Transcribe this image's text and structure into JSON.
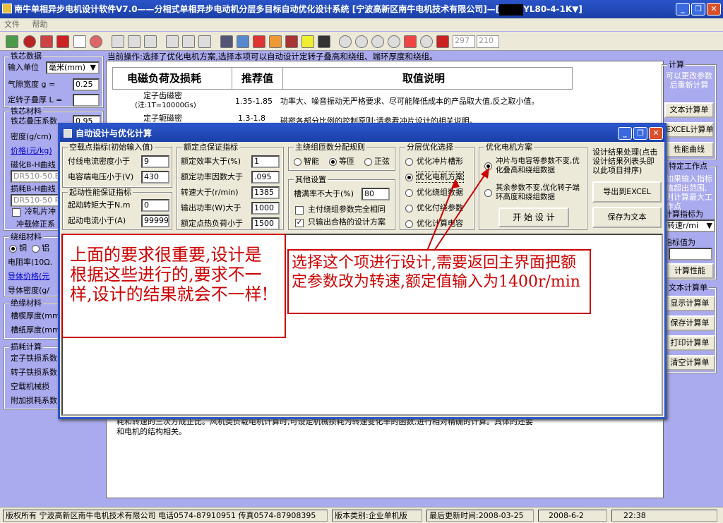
{
  "window": {
    "title": "南牛单相异步电机设计软件V7.0——分相式单相异步电动机分层多目标自动优化设计系统  [宁波高新区南牛电机技术有限公司]—[",
    "title_suffix": "YL80-4-1K▼]",
    "btn_min": "_",
    "btn_max": "❐",
    "btn_close": "✕"
  },
  "menu": {
    "file": "文件",
    "help": "帮助"
  },
  "toolbar": {
    "field1": "297",
    "field2": "210"
  },
  "left": {
    "core_group": "铁芯数据",
    "unit_label": "输入单位",
    "unit_value": "毫米(mm)",
    "gap_label": "气隙宽度  g =",
    "gap_value": "0.25",
    "stack_label": "定转子叠厚 L =",
    "material_group": "铁芯材料",
    "lam_label": "铁芯叠压系数",
    "lam_value": "0.95",
    "density_label": "密度(g/cm)",
    "price_label": "价格(元/kg)",
    "bh1_label": "磁化B-H曲线",
    "bh1_value": "DR510-50.B",
    "loss_label": "损耗B-H曲线",
    "loss_value": "DR510-50 P",
    "punch_label": "冷轧片冲",
    "punch2_label": "冲载修正系",
    "winding_group": "绕组材料",
    "copper": "铜",
    "alu": "铝",
    "resist_label": "电阻率(10Ω.",
    "wireprice_label": "导体价格(元",
    "wiredens_label": "导体密度(g/",
    "insul_group": "绝缘材料",
    "slotwedge_label": "槽楔厚度(mm",
    "slotpaper_label": "槽纸厚度(mm",
    "losscalc_group": "损耗计算",
    "stator_loss": "定子铁损系数",
    "rotor_loss": "转子铁损系数",
    "mech_loss": "空载机械损",
    "add_loss": "附加损耗系数"
  },
  "panel": {
    "op_label": "当前操作:选择了优化电机方案,选择本项可以自动设计定转子叠高和绕组、端环厚度和绕组。",
    "h_loss": "电磁负荷及损耗",
    "h_rec": "推荐值",
    "h_desc": "取值说明",
    "r1_name": "定子齿磁密",
    "r1_sub": "(注:1T=10000Gs)",
    "r1_val": "1.35-1.85",
    "r1_desc": "功率大、噪音振动无严格要求、尽可能降低成本的产品取大值,反之取小值。",
    "r2_name": "定子轭磁密",
    "r2_val": "1.3-1.8",
    "r2_desc": "磁密各部分比例的控制原则:请参看冲片设计的相关说明。",
    "footer1": "耗和转速的三次方成正比。风机类负载电机计算时,可设定机械损耗为转速变化率的函数,进行相对精确的计算。具体的还要",
    "footer2": "和电机的结构相关。"
  },
  "right": {
    "calc_group": "计算",
    "calc_hint": "可以更改参数后重新计算",
    "text_calc": "文本计算单",
    "excel_calc": "EXCEL计算单",
    "perf_curve": "性能曲线",
    "point_group": "特定工作点",
    "point_hint": "如果输入指标值超出范围,则计算最大工作点",
    "point_label": "计算指标为",
    "point_value": "转速r/mi",
    "target_label": "指标值为",
    "calc_perf": "计算性能",
    "textcalc_group": "文本计算单",
    "show_calc": "显示计算单",
    "save_calc": "保存计算单",
    "print_calc": "打印计算单",
    "clear_calc": "清空计算单"
  },
  "dialog": {
    "title": "自动设计与优化计算",
    "noload_group": "空载点指标(初始输入值)",
    "flux_label": "付线电流密度小于",
    "flux_value": "9",
    "cap_label": "电容端电压小于(V)",
    "cap_value": "430",
    "start_group": "起动性能保证指标",
    "torque_label": "起动转矩大于N.m",
    "torque_value": "0",
    "current_label": "起动电流小于(A)",
    "current_value": "99999",
    "rated_group": "额定点保证指标",
    "eff_label": "额定效率大于(%)",
    "eff_value": "1",
    "pf_label": "额定功率因数大于",
    "pf_value": ".095",
    "speed_label": "转速大于(r/min)",
    "speed_value": "1385",
    "power_label": "输出功率(W)大于",
    "power_value": "1000",
    "heat_label": "额定点热负荷小于",
    "heat_value": "1500",
    "rule_group": "主绕组匝数分配规则",
    "rule_smart": "智能",
    "rule_equal": "等匝",
    "rule_sine": "正弦",
    "other_group": "其他设置",
    "fill_label": "槽满率不大于(%)",
    "fill_value": "80",
    "same_wind": "主付绕组参数完全相同",
    "only_ok": "只输出合格的设计方案",
    "layer_group": "分层优化选择",
    "layer1": "优化冲片槽形",
    "layer2": "优化电机方案",
    "layer3": "优化绕组数据",
    "layer4": "优化付绕参数",
    "layer5": "优化计算电容",
    "scheme_group": "优化电机方案",
    "scheme1": "冲片与电容等参数不变,优化叠高和绕组数据",
    "scheme2": "其余参数不变,优化转子端环高度和绕组数据",
    "start_btn": "开 始 设 计",
    "result_title": "设计结果处理(点击设计结果列表头即以此项目排序)",
    "export_btn": "导出到EXCEL",
    "save_btn": "保存为文本",
    "note1": "上面的要求很重要,设计是根据这些进行的,要求不一样,设计的结果就会不一样!",
    "note2": "选择这个项进行设计,需要返回主界面把额定参数改为转速,额定值输入为1400r/min"
  },
  "status": {
    "copyright": "版权所有 宁波高新区南牛电机技术有限公司 电话0574-87910951 传真0574-87908395",
    "edition": "版本类别:企业单机版",
    "updated": "最后更新时间:2008-03-25",
    "date": "2008-6-2",
    "time": "22:38"
  }
}
